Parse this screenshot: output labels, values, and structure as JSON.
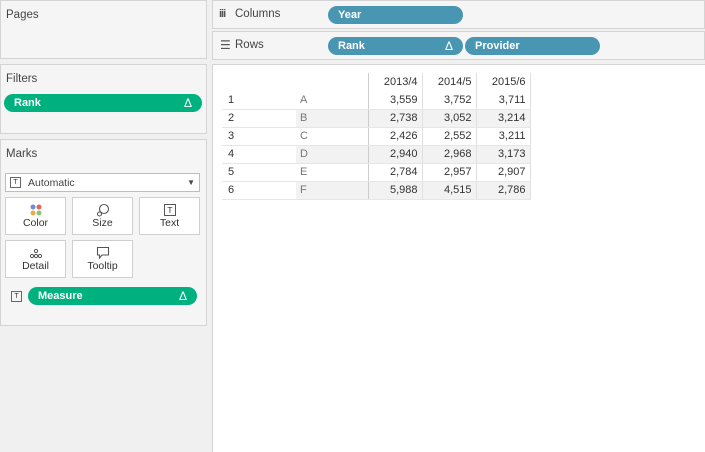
{
  "pages": {
    "title": "Pages"
  },
  "filters": {
    "title": "Filters",
    "pills": [
      {
        "label": "Rank",
        "delta": "Δ"
      }
    ]
  },
  "marks": {
    "title": "Marks",
    "type_icon": "T",
    "mark_type": "Automatic",
    "buttons": [
      {
        "label": "Color",
        "icon": "color-dots-icon"
      },
      {
        "label": "Size",
        "icon": "size-bubble-icon"
      },
      {
        "label": "Text",
        "icon": "text-box-icon"
      },
      {
        "label": "Detail",
        "icon": "detail-dots-icon"
      },
      {
        "label": "Tooltip",
        "icon": "tooltip-bubble-icon"
      }
    ],
    "measure_pill": {
      "label": "Measure",
      "delta": "Δ",
      "icon": "T"
    }
  },
  "shelves": {
    "columns": {
      "label": "Columns",
      "icon": "iii",
      "pills": [
        {
          "label": "Year"
        }
      ]
    },
    "rows": {
      "label": "Rows",
      "icon": "☰",
      "pills": [
        {
          "label": "Rank",
          "delta": "Δ"
        },
        {
          "label": "Provider"
        }
      ]
    }
  },
  "table": {
    "headers": [
      "2013/4",
      "2014/5",
      "2015/6"
    ],
    "rows": [
      {
        "rank": "1",
        "provider": "A",
        "values": [
          "3,559",
          "3,752",
          "3,711"
        ]
      },
      {
        "rank": "2",
        "provider": "B",
        "values": [
          "2,738",
          "3,052",
          "3,214"
        ]
      },
      {
        "rank": "3",
        "provider": "C",
        "values": [
          "2,426",
          "2,552",
          "3,211"
        ]
      },
      {
        "rank": "4",
        "provider": "D",
        "values": [
          "2,940",
          "2,968",
          "3,173"
        ]
      },
      {
        "rank": "5",
        "provider": "E",
        "values": [
          "2,784",
          "2,957",
          "2,907"
        ]
      },
      {
        "rank": "6",
        "provider": "F",
        "values": [
          "5,988",
          "4,515",
          "2,786"
        ]
      }
    ]
  },
  "colors": {
    "blue_pill": "#4996b2",
    "green_pill": "#00b180"
  }
}
